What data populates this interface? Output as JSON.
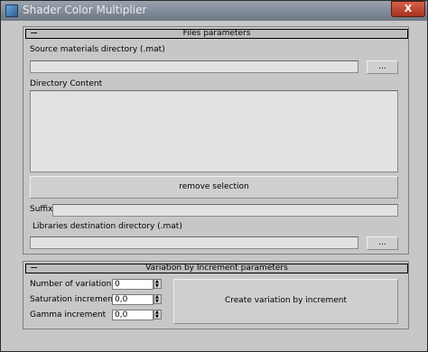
{
  "window": {
    "title": "Shader Color Multiplier",
    "close_label": "X"
  },
  "files": {
    "header": "Files parameters",
    "collapse_glyph": "−",
    "source_label": "Source materials directory (.mat)",
    "source_value": "",
    "browse_label": "...",
    "content_label": "Directory Content",
    "remove_label": "remove selection",
    "suffix_label": "Suffix",
    "suffix_value": "",
    "dest_label": "Libraries destination directory (.mat)",
    "dest_value": ""
  },
  "variation": {
    "header": "Variation by Increment parameters",
    "collapse_glyph": "−",
    "number_label": "Number of variation",
    "number_value": "0",
    "saturation_label": "Saturation increment",
    "saturation_value": "0,0",
    "gamma_label": "Gamma increment",
    "gamma_value": "0,0",
    "create_label": "Create variation by increment"
  }
}
